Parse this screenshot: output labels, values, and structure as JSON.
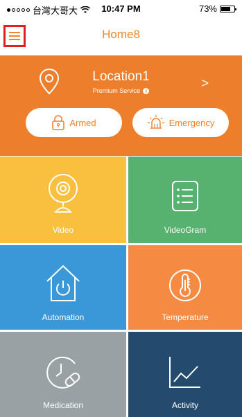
{
  "status_bar": {
    "carrier": "台灣大哥大",
    "time": "10:47 PM",
    "battery": "73%",
    "battery_level": 0.73
  },
  "nav": {
    "title": "Home8",
    "menu_icon": "hamburger-menu-icon"
  },
  "location": {
    "name": "Location1",
    "service": "Premium Service",
    "arrow": ">"
  },
  "actions": {
    "armed_label": "Armed",
    "emergency_label": "Emergency"
  },
  "tiles": [
    {
      "label": "Video",
      "color": "#f9c03f",
      "icon": "camera-icon"
    },
    {
      "label": "VideoGram",
      "color": "#56b26e",
      "icon": "list-icon"
    },
    {
      "label": "Automation",
      "color": "#3a98d8",
      "icon": "house-power-icon"
    },
    {
      "label": "Temperature",
      "color": "#f58a42",
      "icon": "thermometer-icon"
    },
    {
      "label": "Medication",
      "color": "#9aa1a5",
      "icon": "clock-pill-icon"
    },
    {
      "label": "Activity",
      "color": "#244a6e",
      "icon": "line-chart-icon"
    }
  ],
  "colors": {
    "accent": "#ed7f2c",
    "menu_highlight": "#e02020"
  }
}
